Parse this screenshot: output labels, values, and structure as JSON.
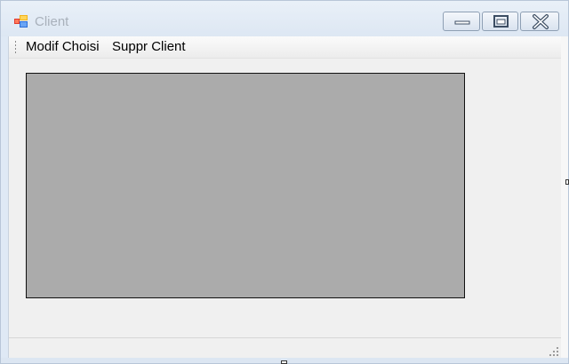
{
  "window": {
    "title": "Client",
    "icon": "app-window-icon",
    "controls": {
      "minimize": "minimize-icon",
      "maximize": "maximize-icon",
      "close": "close-icon"
    }
  },
  "menu": {
    "items": [
      {
        "label": "Modif Choisi"
      },
      {
        "label": "Suppr Client"
      }
    ]
  },
  "colors": {
    "title_text": "#a9b1bb",
    "grid_background": "#ababab",
    "client_background": "#f0f0f0"
  }
}
